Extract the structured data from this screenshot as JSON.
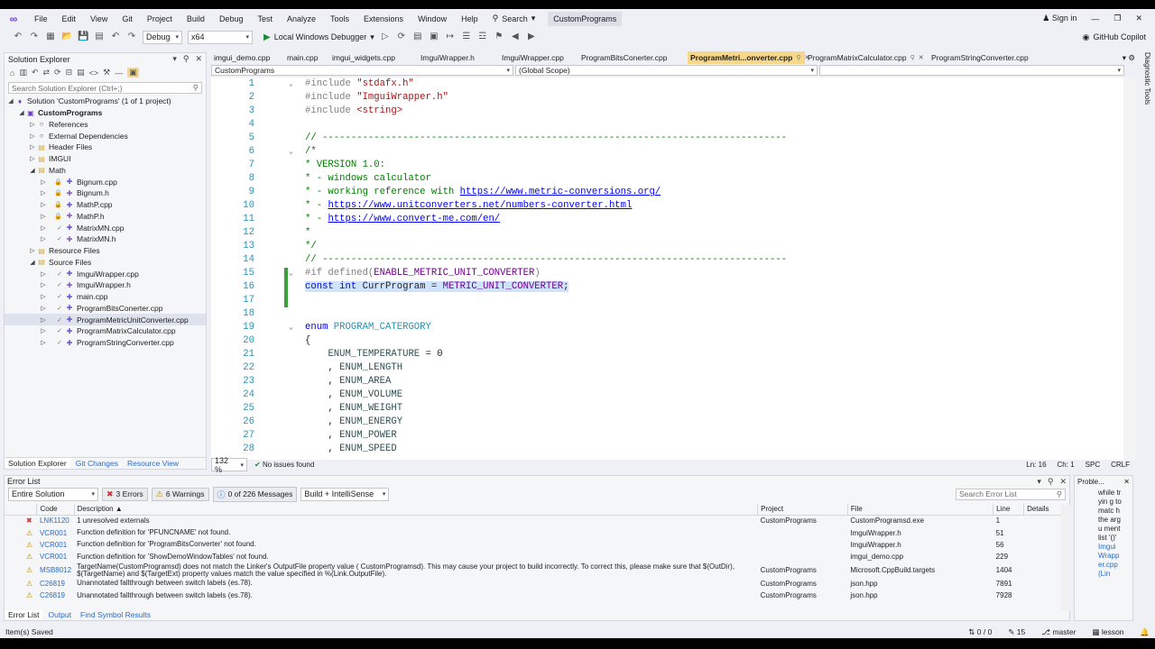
{
  "menu": {
    "items": [
      "File",
      "Edit",
      "View",
      "Git",
      "Project",
      "Build",
      "Debug",
      "Test",
      "Analyze",
      "Tools",
      "Extensions",
      "Window",
      "Help"
    ],
    "search": "Search",
    "project": "CustomPrograms",
    "sign_in": "Sign in"
  },
  "toolbar": {
    "config": "Debug",
    "platform": "x64",
    "run_label": "Local Windows Debugger",
    "copilot": "GitHub Copilot"
  },
  "solution_explorer": {
    "title": "Solution Explorer",
    "search_placeholder": "Search Solution Explorer (Ctrl+;)",
    "items": [
      {
        "label": "Solution 'CustomPrograms' (1 of 1 project)",
        "level": 0,
        "icon": "solution-icon"
      },
      {
        "label": "CustomPrograms",
        "level": 1,
        "icon": "project-icon"
      },
      {
        "label": "References",
        "level": 2,
        "icon": "references-icon"
      },
      {
        "label": "External Dependencies",
        "level": 2,
        "icon": "external-deps-icon"
      },
      {
        "label": "Header Files",
        "level": 2,
        "icon": "folder-icon"
      },
      {
        "label": "IMGUI",
        "level": 2,
        "icon": "folder-icon"
      },
      {
        "label": "Math",
        "level": 2,
        "icon": "folder-icon"
      },
      {
        "label": "Bignum.cpp",
        "level": 3,
        "icon": "cpp-file-icon"
      },
      {
        "label": "Bignum.h",
        "level": 3,
        "icon": "header-file-icon"
      },
      {
        "label": "MathP.cpp",
        "level": 3,
        "icon": "cpp-file-icon"
      },
      {
        "label": "MathP.h",
        "level": 3,
        "icon": "header-file-icon"
      },
      {
        "label": "MatrixMN.cpp",
        "level": 3,
        "icon": "cpp-file-icon"
      },
      {
        "label": "MatrixMN.h",
        "level": 3,
        "icon": "header-file-icon"
      },
      {
        "label": "Resource Files",
        "level": 2,
        "icon": "folder-icon"
      },
      {
        "label": "Source Files",
        "level": 2,
        "icon": "folder-icon"
      },
      {
        "label": "ImguiWrapper.cpp",
        "level": 3,
        "icon": "cpp-file-icon"
      },
      {
        "label": "ImguiWrapper.h",
        "level": 3,
        "icon": "header-file-icon"
      },
      {
        "label": "main.cpp",
        "level": 3,
        "icon": "cpp-file-icon"
      },
      {
        "label": "ProgramBitsConerter.cpp",
        "level": 3,
        "icon": "cpp-file-icon"
      },
      {
        "label": "ProgramMetricUnitConverter.cpp",
        "level": 3,
        "icon": "cpp-file-icon"
      },
      {
        "label": "ProgramMatrixCalculator.cpp",
        "level": 3,
        "icon": "cpp-file-icon"
      },
      {
        "label": "ProgramStringConverter.cpp",
        "level": 3,
        "icon": "cpp-file-icon"
      }
    ],
    "bottom_tabs": [
      "Solution Explorer",
      "Git Changes",
      "Resource View"
    ]
  },
  "editor": {
    "tabs": [
      {
        "label": "imgui_demo.cpp",
        "active": false
      },
      {
        "label": "main.cpp",
        "active": false
      },
      {
        "label": "imgui_widgets.cpp",
        "active": false
      },
      {
        "label": "ImguiWrapper.h",
        "active": false
      },
      {
        "label": "ImguiWrapper.cpp",
        "active": false
      },
      {
        "label": "ProgramBitsConerter.cpp",
        "active": false
      },
      {
        "label": "ProgramMetri...onverter.cpp",
        "active": true
      },
      {
        "label": "ProgramMatrixCalculator.cpp",
        "active": false
      },
      {
        "label": "ProgramStringConverter.cpp",
        "active": false
      }
    ],
    "nav_project": "CustomPrograms",
    "nav_scope": "(Global Scope)",
    "lines": [
      {
        "n": "1",
        "text": "#include \"stdafx.h\""
      },
      {
        "n": "2",
        "text": "#include \"ImguiWrapper.h\""
      },
      {
        "n": "3",
        "text": "#include <string>"
      },
      {
        "n": "4",
        "text": ""
      },
      {
        "n": "5",
        "text": "// ---------------------------------------------------------------------------------"
      },
      {
        "n": "6",
        "text": "/*"
      },
      {
        "n": "7",
        "text": "* VERSION 1.0:"
      },
      {
        "n": "8",
        "text": "* - windows calculator"
      },
      {
        "n": "9",
        "text": "* - working reference with https://www.metric-conversions.org/"
      },
      {
        "n": "10",
        "text": "* - https://www.unitconverters.net/numbers-converter.html"
      },
      {
        "n": "11",
        "text": "* - https://www.convert-me.com/en/"
      },
      {
        "n": "12",
        "text": "*"
      },
      {
        "n": "13",
        "text": "*/"
      },
      {
        "n": "14",
        "text": "// ---------------------------------------------------------------------------------"
      },
      {
        "n": "15",
        "text": "#if defined(ENABLE_METRIC_UNIT_CONVERTER)"
      },
      {
        "n": "16",
        "text": "const int CurrProgram = METRIC_UNIT_CONVERTER;"
      },
      {
        "n": "17",
        "text": ""
      },
      {
        "n": "18",
        "text": ""
      },
      {
        "n": "19",
        "text": "enum PROGRAM_CATERGORY"
      },
      {
        "n": "20",
        "text": "{"
      },
      {
        "n": "21",
        "text": "    ENUM_TEMPERATURE = 0"
      },
      {
        "n": "22",
        "text": "    , ENUM_LENGTH"
      },
      {
        "n": "23",
        "text": "    , ENUM_AREA"
      },
      {
        "n": "24",
        "text": "    , ENUM_VOLUME"
      },
      {
        "n": "25",
        "text": "    , ENUM_WEIGHT"
      },
      {
        "n": "26",
        "text": "    , ENUM_ENERGY"
      },
      {
        "n": "27",
        "text": "    , ENUM_POWER"
      },
      {
        "n": "28",
        "text": "    , ENUM_SPEED"
      }
    ],
    "zoom": "132 %",
    "issues": "No issues found",
    "ln": "Ln: 16",
    "ch": "Ch: 1",
    "spc": "SPC",
    "crlf": "CRLF"
  },
  "error_list": {
    "title": "Error List",
    "scope": "Entire Solution",
    "errors_btn": "3 Errors",
    "warnings_btn": "6 Warnings",
    "messages_btn": "0 of 226 Messages",
    "build_filter": "Build + IntelliSense",
    "search_placeholder": "Search Error List",
    "columns": [
      "Code",
      "Description",
      "Project",
      "File",
      "Line",
      "Details"
    ],
    "rows": [
      {
        "kind": "error",
        "code": "LNK1120",
        "desc": "1 unresolved externals",
        "project": "CustomPrograms",
        "file": "CustomProgramsd.exe",
        "line": "1"
      },
      {
        "kind": "warning",
        "code": "VCR001",
        "desc": "Function definition for 'PFUNCNAME' not found.",
        "project": "",
        "file": "ImguiWrapper.h",
        "line": "51"
      },
      {
        "kind": "warning",
        "code": "VCR001",
        "desc": "Function definition for 'ProgramBitsConverter' not found.",
        "project": "",
        "file": "ImguiWrapper.h",
        "line": "56"
      },
      {
        "kind": "warning",
        "code": "VCR001",
        "desc": "Function definition for 'ShowDemoWindowTables' not found.",
        "project": "",
        "file": "imgui_demo.cpp",
        "line": "229"
      },
      {
        "kind": "warning",
        "code": "MSB8012",
        "desc": "TargetName(CustomProgramsd) does not match the Linker's OutputFile property value ( CustomProgramsd). This may cause your project to build incorrectly. To correct this, please make sure that $(OutDir), $(TargetName) and $(TargetExt) property values match the value specified in %(Link.OutputFile).",
        "project": "CustomPrograms",
        "file": "Microsoft.CppBuild.targets",
        "line": "1404"
      },
      {
        "kind": "warning",
        "code": "C26819",
        "desc": "Unannotated fallthrough between switch labels (es.78).",
        "project": "CustomPrograms",
        "file": "json.hpp",
        "line": "7891"
      },
      {
        "kind": "warning",
        "code": "C26819",
        "desc": "Unannotated fallthrough between switch labels (es.78).",
        "project": "CustomPrograms",
        "file": "json.hpp",
        "line": "7928"
      }
    ],
    "bottom_tabs": [
      "Error List",
      "Output",
      "Find Symbol Results"
    ]
  },
  "problem_details": {
    "title": "Proble...",
    "text": "while tryin g to matc h the argu ment list '()'",
    "link": "ImguiWrapper.cpp (Lin"
  },
  "status": {
    "left": "Item(s) Saved",
    "updown": "0 / 0",
    "edits": "15",
    "branch": "master",
    "repo": "lesson"
  },
  "diagnostic_tools": "Diagnostic Tools"
}
